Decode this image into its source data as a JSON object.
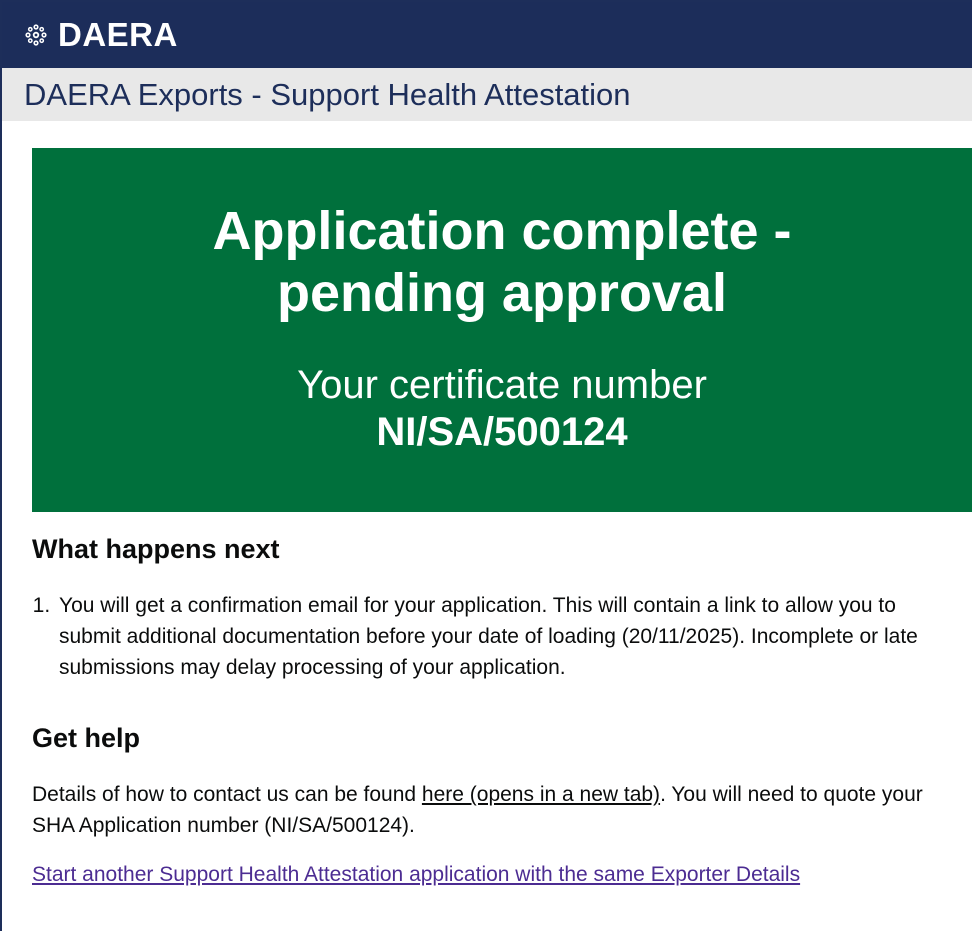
{
  "header": {
    "brand": "DAERA"
  },
  "service": {
    "name": "DAERA Exports - Support Health Attestation"
  },
  "panel": {
    "title_line1": "Application complete -",
    "title_line2": "pending approval",
    "body_label": "Your certificate number",
    "certificate_number": "NI/SA/500124"
  },
  "next": {
    "heading": "What happens next",
    "steps": [
      "You will get a confirmation email for your application. This will contain a link to allow you to submit additional documentation before your date of loading (20/11/2025). Incomplete or late submissions may delay processing of your application."
    ]
  },
  "help": {
    "heading": "Get help",
    "text_before": "Details of how to contact us can be found ",
    "link_text": "here (opens in a new tab)",
    "text_after": ". You will need to quote your SHA Application number (NI/SA/500124)."
  },
  "actions": {
    "start_another_link": "Start another Support Health Attestation application with the same Exporter Details"
  },
  "colors": {
    "header_bg": "#1c2d5a",
    "service_bg": "#e8e8e8",
    "panel_bg": "#00703c",
    "visited_link": "#4c2c92"
  },
  "icons": {
    "logo": "daera-crest-icon"
  }
}
